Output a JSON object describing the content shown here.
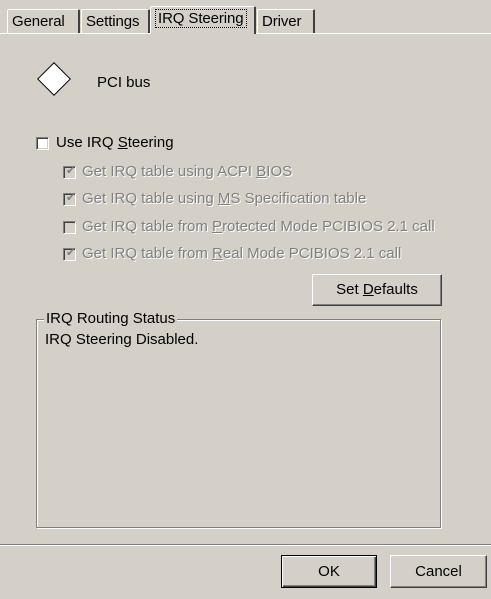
{
  "tabs": [
    {
      "label": "General"
    },
    {
      "label": "Settings"
    },
    {
      "label": "IRQ Steering"
    },
    {
      "label": "Driver"
    }
  ],
  "device": {
    "name": "PCI bus",
    "icon": "diamond-icon"
  },
  "use_irq": {
    "label_pre": "Use IRQ ",
    "label_u": "S",
    "label_post": "teering",
    "checked": false
  },
  "options": [
    {
      "pre": "Get IRQ table using ACPI ",
      "u": "B",
      "post": "IOS",
      "checked": true
    },
    {
      "pre": "Get IRQ table using ",
      "u": "M",
      "post": "S Specification table",
      "checked": true
    },
    {
      "pre": "Get IRQ table from ",
      "u": "P",
      "post": "rotected Mode PCIBIOS 2.1 call",
      "checked": false
    },
    {
      "pre": "Get IRQ table from ",
      "u": "R",
      "post": "eal Mode PCIBIOS 2.1 call",
      "checked": true
    }
  ],
  "set_defaults": {
    "pre": "Set ",
    "u": "D",
    "post": "efaults"
  },
  "routing": {
    "title": "IRQ Routing Status",
    "status": "IRQ Steering Disabled."
  },
  "footer": {
    "ok": "OK",
    "cancel": "Cancel"
  }
}
